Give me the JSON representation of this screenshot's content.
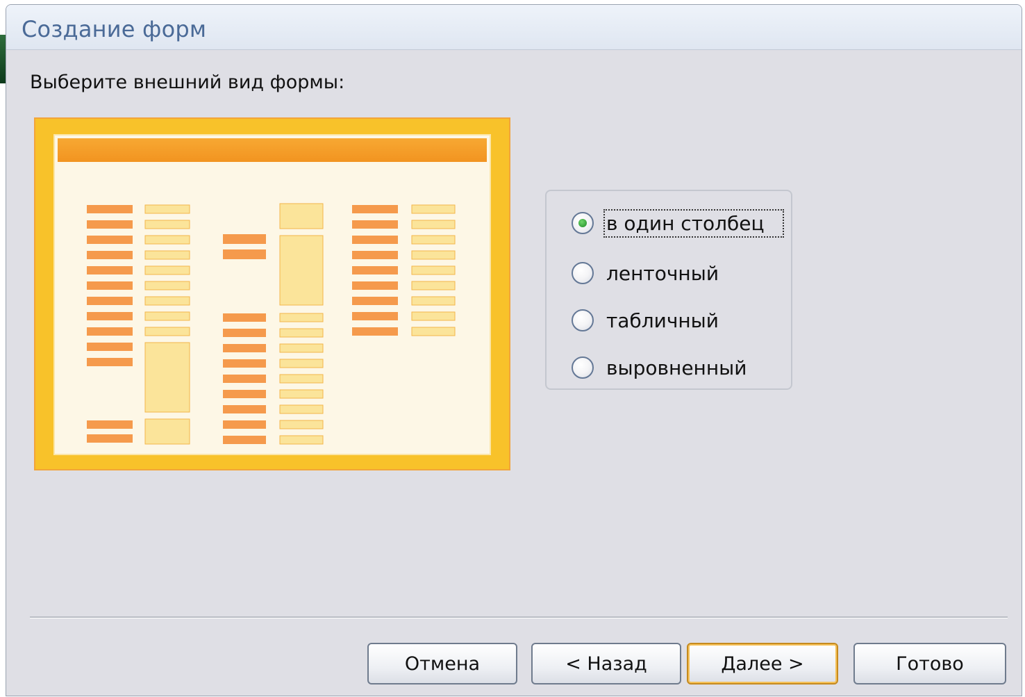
{
  "window": {
    "title": "Создание форм"
  },
  "prompt": "Выберите внешний вид формы:",
  "layout_options": [
    {
      "label": "в один столбец",
      "checked": true
    },
    {
      "label": "ленточный",
      "checked": false
    },
    {
      "label": "табличный",
      "checked": false
    },
    {
      "label": "выровненный",
      "checked": false
    }
  ],
  "buttons": {
    "cancel": "Отмена",
    "back": "< Назад",
    "next": "Далее >",
    "finish": "Готово"
  },
  "colors": {
    "preview_frame": "#f8c22a",
    "preview_header": "#f29420",
    "label_bar": "#f59a4c",
    "field_box": "#fbe49a",
    "title_text": "#4a6a97"
  }
}
